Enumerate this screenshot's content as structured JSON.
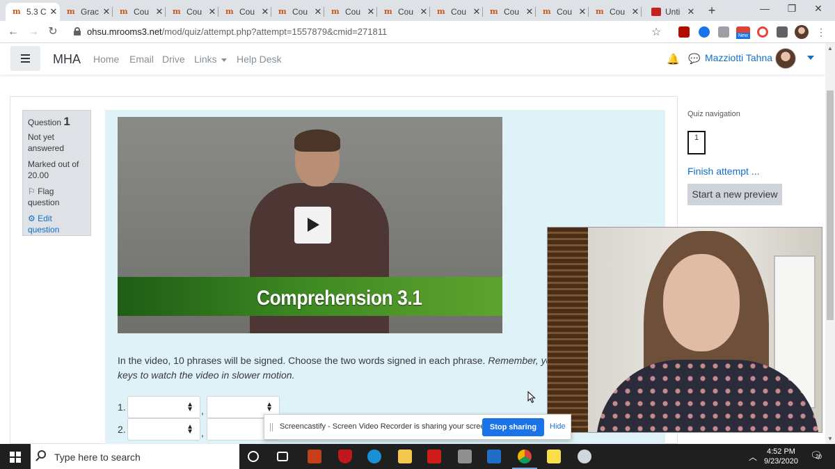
{
  "browser": {
    "tabs": [
      {
        "title": "5.3 C",
        "active": true,
        "icon": "moodle-icon"
      },
      {
        "title": "Grac",
        "icon": "moodle-icon"
      },
      {
        "title": "Cou",
        "icon": "moodle-icon"
      },
      {
        "title": "Cou",
        "icon": "moodle-icon"
      },
      {
        "title": "Cou",
        "icon": "moodle-icon"
      },
      {
        "title": "Cou",
        "icon": "moodle-icon"
      },
      {
        "title": "Cou",
        "icon": "moodle-icon"
      },
      {
        "title": "Cou",
        "icon": "moodle-icon"
      },
      {
        "title": "Cou",
        "icon": "moodle-icon"
      },
      {
        "title": "Cou",
        "icon": "moodle-icon"
      },
      {
        "title": "Cou",
        "icon": "moodle-icon"
      },
      {
        "title": "Cou",
        "icon": "moodle-icon"
      },
      {
        "title": "Unti",
        "icon": "calendar-icon"
      }
    ],
    "url_host": "ohsu.mrooms3.net",
    "url_path": "/mod/quiz/attempt.php?attempt=1557879&cmid=271811",
    "ext_badge": "New"
  },
  "navbar": {
    "brand": "MHA",
    "links": [
      "Home",
      "Email",
      "Drive",
      "Links",
      "Help Desk"
    ],
    "username": "Mazziotti Tahna"
  },
  "question_info": {
    "label": "Question",
    "number": "1",
    "state": "Not yet answered",
    "marked_out_of": "Marked out of 20.00",
    "flag": "Flag question",
    "edit": "Edit question"
  },
  "video": {
    "banner_text": "Comprehension 3.1"
  },
  "question": {
    "text_plain": "In the video, 10 phrases will be signed. Choose the two words signed in each phrase. ",
    "text_italic_1": "Remember, you",
    "text_italic_2": "keys to watch the video in slower motion.",
    "rows": [
      {
        "label": "1.",
        "sep": ","
      },
      {
        "label": "2.",
        "sep": ","
      }
    ]
  },
  "quiz_nav": {
    "title": "Quiz navigation",
    "button_label": "1",
    "finish": "Finish attempt ...",
    "new_preview": "Start a new preview"
  },
  "screencastify": {
    "message": "Screencastify - Screen Video Recorder is sharing your screen.",
    "stop": "Stop sharing",
    "hide": "Hide"
  },
  "taskbar": {
    "search_placeholder": "Type here to search",
    "time": "4:52 PM",
    "date": "9/23/2020",
    "notifications": "20"
  },
  "colors": {
    "link": "#0f6fc5",
    "question_bg": "#def2f8",
    "info_bg": "#dee2e6",
    "share_button": "#1a73e8"
  }
}
